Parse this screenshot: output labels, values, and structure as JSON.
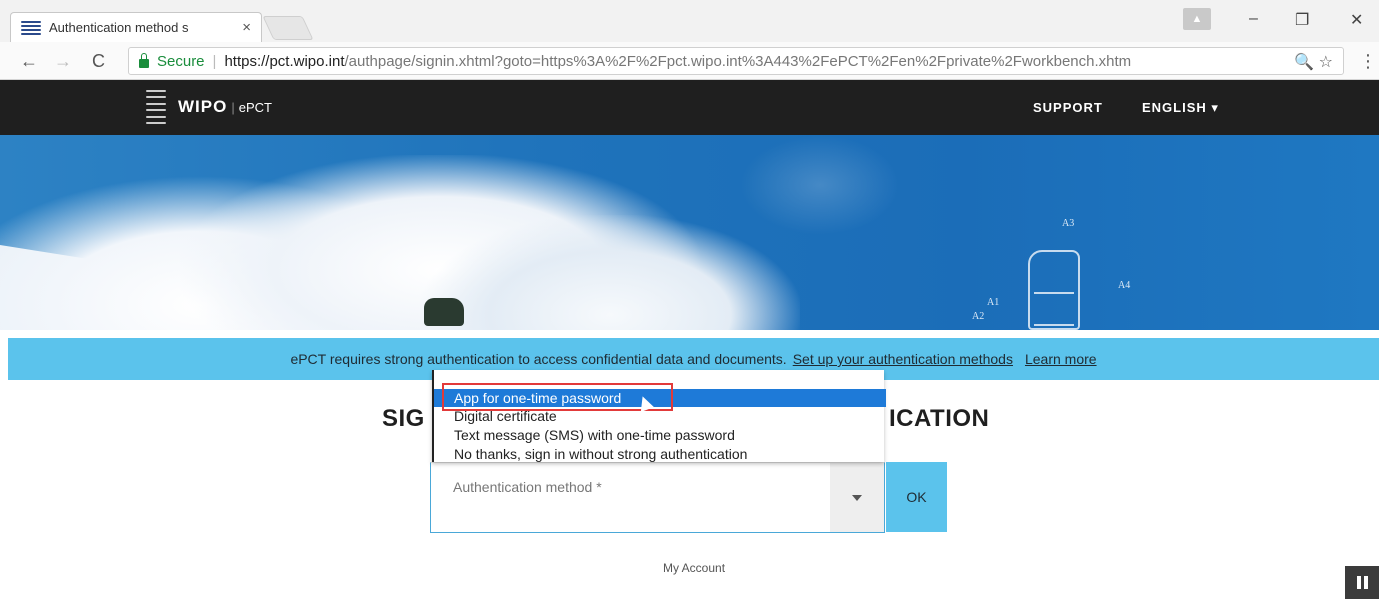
{
  "browser": {
    "tab_title": "Authentication method s",
    "tab_close": "×",
    "minimize": "–",
    "restore": "❐",
    "close": "✕",
    "back": "←",
    "forward": "→",
    "reload": "C",
    "secure_label": "Secure",
    "url_host": "https://pct.wipo.int",
    "url_path": "/authpage/signin.xhtml?goto=https%3A%2F%2Fpct.wipo.int%3A443%2FePCT%2Fen%2Fprivate%2Fworkbench.xhtm",
    "zoom_icon": "🔍",
    "star_icon": "☆",
    "menu_icon": "⋮"
  },
  "header": {
    "logo_text": "WIPO",
    "logo_sep": "|",
    "logo_product": "ePCT",
    "nav": {
      "support": "SUPPORT",
      "language": "ENGLISH ▾"
    }
  },
  "hero": {
    "labels": [
      "A3",
      "A4",
      "A1",
      "A2"
    ]
  },
  "notice": {
    "text": "ePCT requires strong authentication to access confidential data and documents.",
    "setup_link": "Set up your authentication methods",
    "learn_more": "Learn more"
  },
  "main": {
    "title_left": "SIG",
    "title_right": "ICATION",
    "select": {
      "placeholder": "Authentication method *",
      "options": [
        "App for one-time password",
        "Digital certificate",
        "Text message (SMS) with one-time password",
        "No thanks, sign in without strong authentication"
      ],
      "highlighted_index": 0
    },
    "ok_label": "OK",
    "my_account": "My Account"
  },
  "colors": {
    "header_bg": "#1f1f1f",
    "notice_bg": "#5bc3ec",
    "ok_bg": "#5bc3ec",
    "highlight": "#1e7ad8",
    "outline": "#e23a3a"
  }
}
